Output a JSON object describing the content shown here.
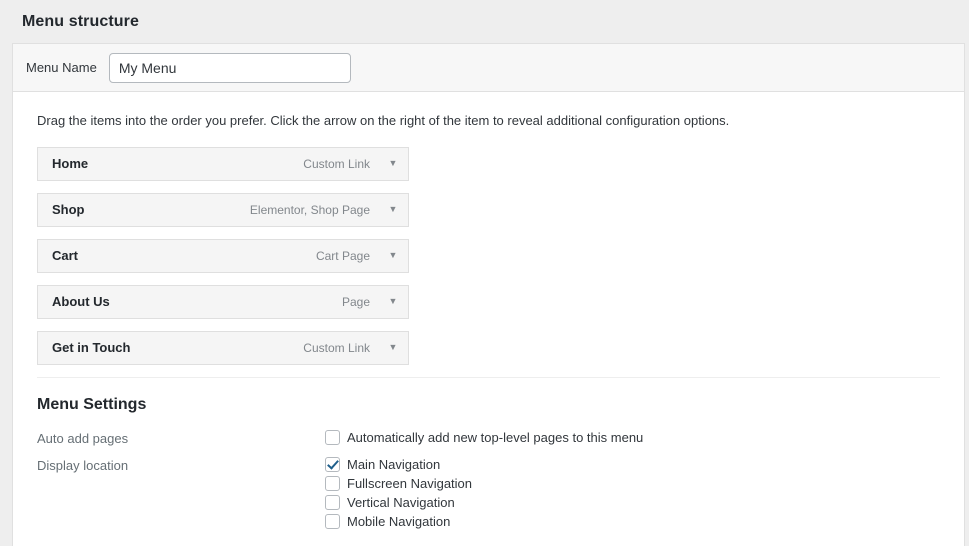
{
  "page": {
    "title": "Menu structure"
  },
  "menu_name": {
    "label": "Menu Name",
    "value": "My Menu",
    "placeholder": "Menu Name"
  },
  "drag_hint": "Drag the items into the order you prefer. Click the arrow on the right of the item to reveal additional configuration options.",
  "menu_items": [
    {
      "title": "Home",
      "type": "Custom Link",
      "toggle": "▼"
    },
    {
      "title": "Shop",
      "type": "Elementor, Shop Page",
      "toggle": "▼"
    },
    {
      "title": "Cart",
      "type": "Cart Page",
      "toggle": "▼"
    },
    {
      "title": "About Us",
      "type": "Page",
      "toggle": "▼"
    },
    {
      "title": "Get in Touch",
      "type": "Custom Link",
      "toggle": "▼"
    }
  ],
  "settings": {
    "title": "Menu Settings",
    "auto_add": {
      "label": "Auto add pages",
      "option_label": "Automatically add new top-level pages to this menu",
      "checked": false
    },
    "display_location": {
      "label": "Display location",
      "options": [
        {
          "label": "Main Navigation",
          "checked": true
        },
        {
          "label": "Fullscreen Navigation",
          "checked": false
        },
        {
          "label": "Vertical Navigation",
          "checked": false
        },
        {
          "label": "Mobile Navigation",
          "checked": false
        }
      ]
    }
  },
  "colors": {
    "accent_check": "#1f5f8b",
    "panel_bg": "#ffffff",
    "row_bg": "#f5f5f5",
    "page_bg": "#eeeeee"
  }
}
